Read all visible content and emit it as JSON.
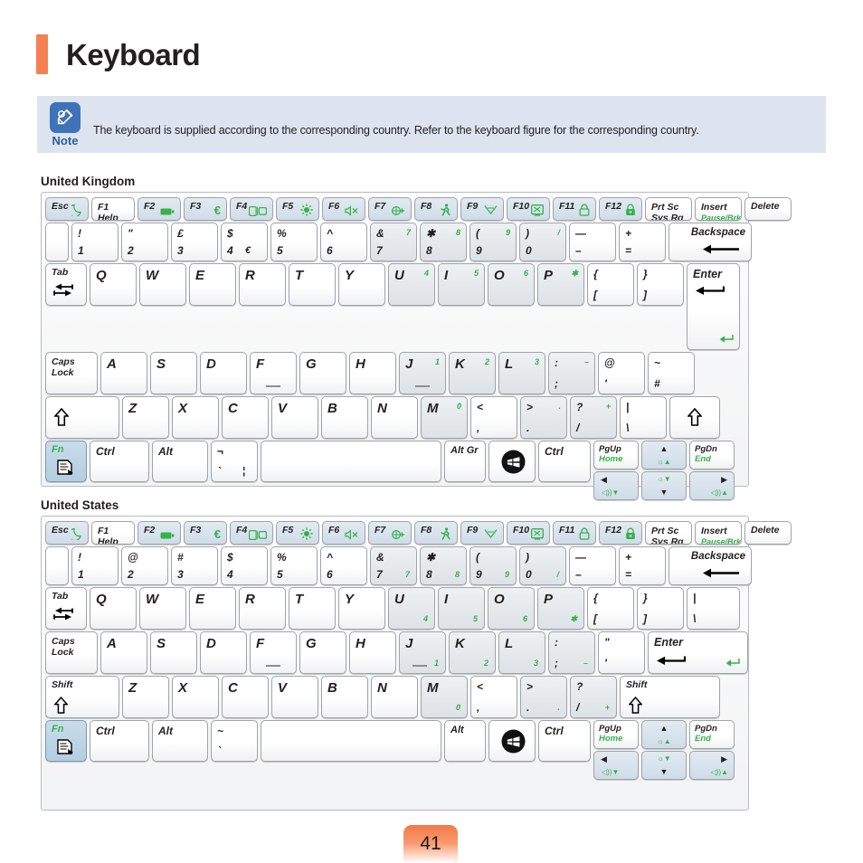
{
  "page": {
    "title": "Keyboard",
    "page_number": "41",
    "accent_color": "#f58053",
    "note_accent_color": "#3e72b9",
    "fn_green": "#35b24a"
  },
  "note": {
    "label": "Note",
    "icon": "pencil-icon",
    "text": "The keyboard is supplied according to the corresponding country. Refer to the keyboard figure for the corresponding country."
  },
  "sections": {
    "uk_heading": "United Kingdom",
    "us_heading": "United States"
  },
  "uk_keyboard": {
    "fn_row": [
      {
        "top": "Esc",
        "icon": "moon-icon",
        "style": "blue"
      },
      {
        "top": "F1",
        "bottom": "Help",
        "style": "white"
      },
      {
        "top": "F2",
        "icon": "battery-icon",
        "style": "blue"
      },
      {
        "top": "F3",
        "icon": "euro-icon",
        "style": "blue"
      },
      {
        "top": "F4",
        "icon": "display-switch-icon",
        "style": "blue"
      },
      {
        "top": "F5",
        "icon": "brightness-icon",
        "style": "blue"
      },
      {
        "top": "F6",
        "icon": "mute-icon",
        "style": "blue"
      },
      {
        "top": "F7",
        "icon": "network-icon",
        "style": "blue"
      },
      {
        "top": "F8",
        "icon": "performance-icon",
        "style": "blue"
      },
      {
        "top": "F9",
        "icon": "wireless-icon",
        "style": "blue"
      },
      {
        "top": "F10",
        "icon": "touchpad-icon",
        "style": "blue"
      },
      {
        "top": "F11",
        "icon": "lock-icon",
        "style": "blue"
      },
      {
        "top": "F12",
        "icon": "secure-lock-icon",
        "style": "blue"
      },
      {
        "top": "Prt Sc",
        "bottom": "Sys Rq",
        "style": "white"
      },
      {
        "top": "Insert",
        "bottom": "Pause/Brk",
        "bottom_green": true,
        "style": "white"
      },
      {
        "top": "Delete",
        "style": "white"
      }
    ],
    "num_row": [
      {
        "top": "",
        "bottom": "",
        "style": "white",
        "narrow": true
      },
      {
        "top": "!",
        "bottom": "1",
        "style": "white"
      },
      {
        "top": "\"",
        "bottom": "2",
        "style": "white"
      },
      {
        "top": "£",
        "bottom": "3",
        "style": "white"
      },
      {
        "top": "$",
        "bottom": "4",
        "extra": "€",
        "style": "white"
      },
      {
        "top": "%",
        "bottom": "5",
        "style": "white"
      },
      {
        "top": "^",
        "bottom": "6",
        "style": "white"
      },
      {
        "top": "&",
        "bottom": "7",
        "num": "7",
        "style": "gray"
      },
      {
        "top": "✱",
        "bottom": "8",
        "num": "8",
        "style": "gray"
      },
      {
        "top": "(",
        "bottom": "9",
        "num": "9",
        "style": "gray"
      },
      {
        "top": ")",
        "bottom": "0",
        "num": "/",
        "style": "gray"
      },
      {
        "top": "—",
        "bottom": "–",
        "style": "white"
      },
      {
        "top": "+",
        "bottom": "=",
        "style": "white"
      },
      {
        "top": "Backspace",
        "icon": "backspace-arrow-icon",
        "style": "white",
        "wide": true
      }
    ],
    "qwerty_row": [
      {
        "top": "Tab",
        "icon": "tab-arrows-icon",
        "style": "white"
      },
      {
        "letter": "Q",
        "style": "white"
      },
      {
        "letter": "W",
        "style": "white"
      },
      {
        "letter": "E",
        "style": "white"
      },
      {
        "letter": "R",
        "style": "white"
      },
      {
        "letter": "T",
        "style": "white"
      },
      {
        "letter": "Y",
        "style": "white"
      },
      {
        "letter": "U",
        "num": "4",
        "style": "gray"
      },
      {
        "letter": "I",
        "num": "5",
        "style": "gray"
      },
      {
        "letter": "O",
        "num": "6",
        "style": "gray"
      },
      {
        "letter": "P",
        "num": "✱",
        "style": "gray"
      },
      {
        "top": "{",
        "bottom": "[",
        "style": "white"
      },
      {
        "top": "}",
        "bottom": "]",
        "style": "white"
      },
      {
        "top": "Enter",
        "icon": "enter-arrow-icon",
        "style": "white",
        "wide": true
      }
    ],
    "asdf_row": [
      {
        "top": "Caps",
        "bottom": "Lock",
        "style": "white"
      },
      {
        "letter": "A",
        "style": "white"
      },
      {
        "letter": "S",
        "style": "white"
      },
      {
        "letter": "D",
        "style": "white"
      },
      {
        "letter": "F",
        "style": "white",
        "homebar": true
      },
      {
        "letter": "G",
        "style": "white"
      },
      {
        "letter": "H",
        "style": "white"
      },
      {
        "letter": "J",
        "num": "1",
        "style": "gray",
        "homebar": true
      },
      {
        "letter": "K",
        "num": "2",
        "style": "gray"
      },
      {
        "letter": "L",
        "num": "3",
        "style": "gray"
      },
      {
        "top": ":",
        "bottom": ";",
        "num": "–",
        "style": "gray"
      },
      {
        "top": "@",
        "bottom": "'",
        "style": "white"
      },
      {
        "top": "~",
        "bottom": "#",
        "style": "white"
      }
    ],
    "zxcv_row": [
      {
        "icon": "shift-up-arrow-icon",
        "style": "white",
        "wide": true
      },
      {
        "letter": "Z",
        "style": "white"
      },
      {
        "letter": "X",
        "style": "white"
      },
      {
        "letter": "C",
        "style": "white"
      },
      {
        "letter": "V",
        "style": "white"
      },
      {
        "letter": "B",
        "style": "white"
      },
      {
        "letter": "N",
        "style": "white"
      },
      {
        "letter": "M",
        "num": "0",
        "style": "gray"
      },
      {
        "top": "<",
        "bottom": ",",
        "style": "white"
      },
      {
        "top": ">",
        "bottom": ".",
        "num": ".",
        "style": "gray"
      },
      {
        "top": "?",
        "bottom": "/",
        "num": "+",
        "style": "gray"
      },
      {
        "top": "|",
        "bottom": "\\",
        "style": "white"
      },
      {
        "icon": "shift-up-arrow-icon",
        "style": "white"
      }
    ],
    "bottom_row": [
      {
        "top": "Fn",
        "icon": "fn-doc-icon",
        "style": "fn"
      },
      {
        "top": "Ctrl",
        "style": "white"
      },
      {
        "top": "Alt",
        "style": "white"
      },
      {
        "top": "¬",
        "bottom": "`",
        "extra": "¦",
        "style": "white"
      },
      {
        "label": "space",
        "style": "white"
      },
      {
        "top": "Alt Gr",
        "style": "white"
      },
      {
        "icon": "windows-logo-icon",
        "style": "white"
      },
      {
        "top": "Ctrl",
        "style": "white"
      }
    ],
    "nav_cluster": {
      "pgup": {
        "top": "PgUp",
        "bottom": "Home"
      },
      "up": {
        "icon": "up-arrow-icon",
        "fn_icon": "brightness-up-icon"
      },
      "pgdn": {
        "top": "PgDn",
        "bottom": "End"
      },
      "left": {
        "icon": "left-arrow-icon",
        "fn_icon": "volume-down-icon"
      },
      "down": {
        "icon": "down-arrow-icon",
        "fn_icon": "brightness-down-icon"
      },
      "right": {
        "icon": "right-arrow-icon",
        "fn_icon": "volume-up-icon"
      }
    }
  },
  "us_keyboard": {
    "fn_row": [
      {
        "top": "Esc",
        "icon": "moon-icon",
        "style": "blue"
      },
      {
        "top": "F1",
        "bottom": "Help",
        "style": "white"
      },
      {
        "top": "F2",
        "icon": "battery-icon",
        "style": "blue"
      },
      {
        "top": "F3",
        "icon": "euro-icon",
        "style": "blue"
      },
      {
        "top": "F4",
        "icon": "display-switch-icon",
        "style": "blue"
      },
      {
        "top": "F5",
        "icon": "brightness-icon",
        "style": "blue"
      },
      {
        "top": "F6",
        "icon": "mute-icon",
        "style": "blue"
      },
      {
        "top": "F7",
        "icon": "network-icon",
        "style": "blue"
      },
      {
        "top": "F8",
        "icon": "performance-icon",
        "style": "blue"
      },
      {
        "top": "F9",
        "icon": "wireless-icon",
        "style": "blue"
      },
      {
        "top": "F10",
        "icon": "touchpad-icon",
        "style": "blue"
      },
      {
        "top": "F11",
        "icon": "lock-icon",
        "style": "blue"
      },
      {
        "top": "F12",
        "icon": "secure-lock-icon",
        "style": "blue"
      },
      {
        "top": "Prt Sc",
        "bottom": "Sys Rq",
        "style": "white"
      },
      {
        "top": "Insert",
        "bottom": "Pause/Brk",
        "bottom_green": true,
        "style": "white"
      },
      {
        "top": "Delete",
        "style": "white"
      }
    ],
    "num_row": [
      {
        "top": "",
        "bottom": "",
        "style": "white",
        "narrow": true
      },
      {
        "top": "!",
        "bottom": "1",
        "style": "white"
      },
      {
        "top": "@",
        "bottom": "2",
        "style": "white"
      },
      {
        "top": "#",
        "bottom": "3",
        "style": "white"
      },
      {
        "top": "$",
        "bottom": "4",
        "style": "white"
      },
      {
        "top": "%",
        "bottom": "5",
        "style": "white"
      },
      {
        "top": "^",
        "bottom": "6",
        "style": "white"
      },
      {
        "top": "&",
        "bottom": "7",
        "num_br": "7",
        "style": "gray"
      },
      {
        "top": "✱",
        "bottom": "8",
        "num_br": "8",
        "style": "gray"
      },
      {
        "top": "(",
        "bottom": "9",
        "num_br": "9",
        "style": "gray"
      },
      {
        "top": ")",
        "bottom": "0",
        "num_br": "/",
        "style": "gray"
      },
      {
        "top": "—",
        "bottom": "–",
        "style": "white"
      },
      {
        "top": "+",
        "bottom": "=",
        "style": "white"
      },
      {
        "top": "Backspace",
        "icon": "backspace-arrow-icon",
        "style": "white",
        "wide": true
      }
    ],
    "qwerty_row": [
      {
        "top": "Tab",
        "icon": "tab-arrows-icon",
        "style": "white"
      },
      {
        "letter": "Q",
        "style": "white"
      },
      {
        "letter": "W",
        "style": "white"
      },
      {
        "letter": "E",
        "style": "white"
      },
      {
        "letter": "R",
        "style": "white"
      },
      {
        "letter": "T",
        "style": "white"
      },
      {
        "letter": "Y",
        "style": "white"
      },
      {
        "letter": "U",
        "num_br": "4",
        "style": "gray"
      },
      {
        "letter": "I",
        "num_br": "5",
        "style": "gray"
      },
      {
        "letter": "O",
        "num_br": "6",
        "style": "gray"
      },
      {
        "letter": "P",
        "num_br": "✱",
        "style": "gray"
      },
      {
        "top": "{",
        "bottom": "[",
        "style": "white"
      },
      {
        "top": "}",
        "bottom": "]",
        "style": "white"
      },
      {
        "top": "|",
        "bottom": "\\",
        "style": "white"
      }
    ],
    "asdf_row": [
      {
        "top": "Caps",
        "bottom": "Lock",
        "style": "white"
      },
      {
        "letter": "A",
        "style": "white"
      },
      {
        "letter": "S",
        "style": "white"
      },
      {
        "letter": "D",
        "style": "white"
      },
      {
        "letter": "F",
        "style": "white",
        "homebar": true
      },
      {
        "letter": "G",
        "style": "white"
      },
      {
        "letter": "H",
        "style": "white"
      },
      {
        "letter": "J",
        "num_br": "1",
        "style": "gray",
        "homebar": true
      },
      {
        "letter": "K",
        "num_br": "2",
        "style": "gray"
      },
      {
        "letter": "L",
        "num_br": "3",
        "style": "gray"
      },
      {
        "top": ":",
        "bottom": ";",
        "num_br": "–",
        "style": "gray"
      },
      {
        "top": "\"",
        "bottom": "'",
        "style": "white"
      },
      {
        "top": "Enter",
        "icon": "enter-arrow-icon",
        "style": "white",
        "wide": true
      }
    ],
    "zxcv_row": [
      {
        "top": "Shift",
        "icon": "shift-up-arrow-icon",
        "style": "white",
        "wide": true
      },
      {
        "letter": "Z",
        "style": "white"
      },
      {
        "letter": "X",
        "style": "white"
      },
      {
        "letter": "C",
        "style": "white"
      },
      {
        "letter": "V",
        "style": "white"
      },
      {
        "letter": "B",
        "style": "white"
      },
      {
        "letter": "N",
        "style": "white"
      },
      {
        "letter": "M",
        "num_br": "0",
        "style": "gray"
      },
      {
        "top": "<",
        "bottom": ",",
        "style": "white"
      },
      {
        "top": ">",
        "bottom": ".",
        "num_br": ".",
        "style": "gray"
      },
      {
        "top": "?",
        "bottom": "/",
        "num_br": "+",
        "style": "gray"
      },
      {
        "top": "Shift",
        "icon": "shift-up-arrow-icon",
        "style": "white",
        "wide": true
      }
    ],
    "bottom_row": [
      {
        "top": "Fn",
        "icon": "fn-doc-icon",
        "style": "fn"
      },
      {
        "top": "Ctrl",
        "style": "white"
      },
      {
        "top": "Alt",
        "style": "white"
      },
      {
        "top": "~",
        "bottom": "`",
        "style": "white"
      },
      {
        "label": "space",
        "style": "white"
      },
      {
        "top": "Alt",
        "style": "white"
      },
      {
        "icon": "windows-logo-icon",
        "style": "white"
      },
      {
        "top": "Ctrl",
        "style": "white"
      }
    ],
    "nav_cluster": {
      "pgup": {
        "top": "PgUp",
        "bottom": "Home"
      },
      "up": {
        "icon": "up-arrow-icon",
        "fn_icon": "brightness-up-icon"
      },
      "pgdn": {
        "top": "PgDn",
        "bottom": "End"
      },
      "left": {
        "icon": "left-arrow-icon",
        "fn_icon": "volume-down-icon"
      },
      "down": {
        "icon": "down-arrow-icon",
        "fn_icon": "brightness-down-icon"
      },
      "right": {
        "icon": "right-arrow-icon",
        "fn_icon": "volume-up-icon"
      }
    }
  }
}
